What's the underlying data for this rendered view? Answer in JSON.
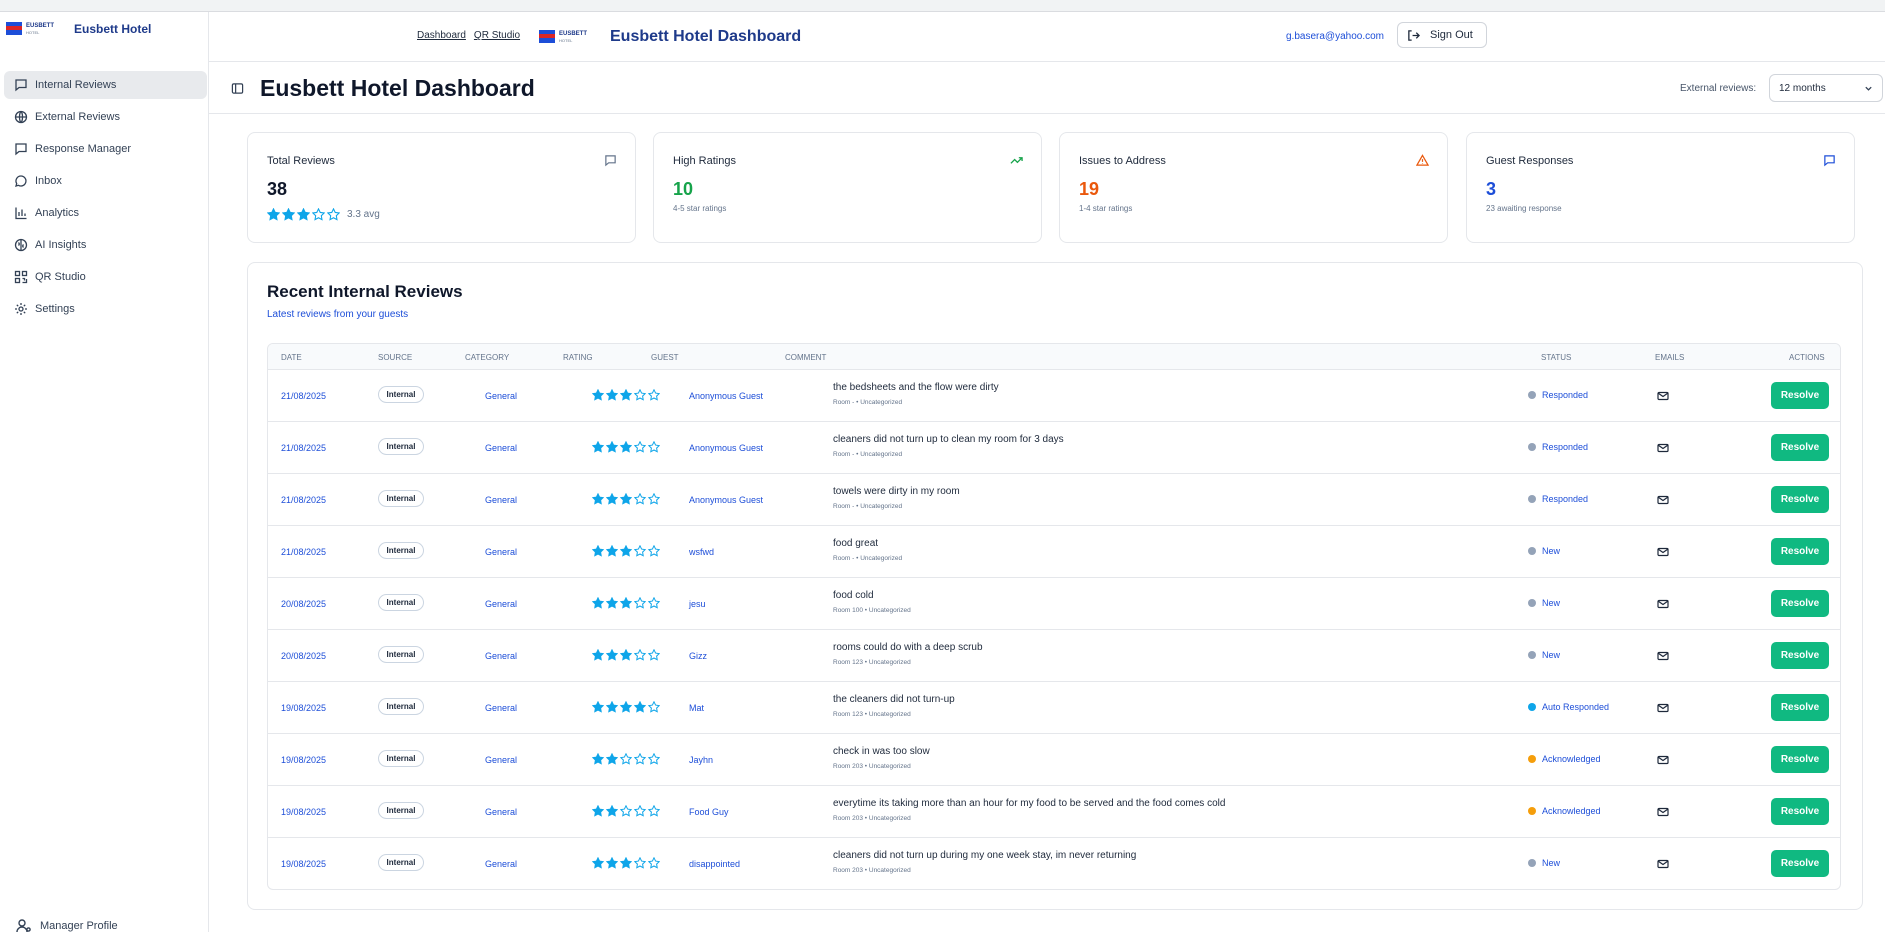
{
  "brand": {
    "name": "Eusbett Hotel",
    "logo_text": "EUSBETT",
    "logo_subtext": "HOTEL"
  },
  "sidebar": {
    "items": [
      {
        "label": "Internal Reviews",
        "icon": "message-square-icon",
        "active": true
      },
      {
        "label": "External Reviews",
        "icon": "globe-icon",
        "active": false
      },
      {
        "label": "Response Manager",
        "icon": "message-square-icon",
        "active": false
      },
      {
        "label": "Inbox",
        "icon": "message-circle-icon",
        "active": false
      },
      {
        "label": "Analytics",
        "icon": "bar-chart-icon",
        "active": false
      },
      {
        "label": "AI Insights",
        "icon": "brain-icon",
        "active": false
      },
      {
        "label": "QR Studio",
        "icon": "qr-code-icon",
        "active": false
      },
      {
        "label": "Settings",
        "icon": "gear-icon",
        "active": false
      }
    ],
    "profile_label": "Manager Profile"
  },
  "header": {
    "links": [
      "Dashboard",
      "QR Studio"
    ],
    "title": "Eusbett Hotel Dashboard",
    "email": "g.basera@yahoo.com",
    "signout_label": "Sign Out"
  },
  "page": {
    "title": "Eusbett Hotel Dashboard",
    "external_label": "External reviews:",
    "external_value": "12 months"
  },
  "stats": [
    {
      "title": "Total Reviews",
      "value": "38",
      "sub": "3.3 avg",
      "icon": "message-square-icon",
      "color": "#0f172a",
      "stars": 3
    },
    {
      "title": "High Ratings",
      "value": "10",
      "sub": "4-5 star ratings",
      "icon": "trending-up-icon",
      "color": "#16a34a"
    },
    {
      "title": "Issues to Address",
      "value": "19",
      "sub": "1-4 star ratings",
      "icon": "alert-triangle-icon",
      "color": "#ea580c"
    },
    {
      "title": "Guest Responses",
      "value": "3",
      "sub": "23 awaiting response",
      "icon": "message-square-icon",
      "color": "#1d4ed8"
    }
  ],
  "reviews": {
    "title": "Recent Internal Reviews",
    "subtitle": "Latest reviews from your guests",
    "columns": [
      "Date",
      "Source",
      "Category",
      "Rating",
      "Guest",
      "Comment",
      "Status",
      "Emails",
      "Actions"
    ],
    "rows": [
      {
        "date": "21/08/2025",
        "source": "Internal",
        "category": "General",
        "rating": 3,
        "guest": "Anonymous Guest",
        "comment": "the bedsheets and the flow were dirty",
        "meta": "Room - • Uncategorized",
        "status": "Responded",
        "status_color": "#94a3b8",
        "action": "Resolve"
      },
      {
        "date": "21/08/2025",
        "source": "Internal",
        "category": "General",
        "rating": 3,
        "guest": "Anonymous Guest",
        "comment": "cleaners did not turn up to clean my room for 3 days",
        "meta": "Room - • Uncategorized",
        "status": "Responded",
        "status_color": "#94a3b8",
        "action": "Resolve"
      },
      {
        "date": "21/08/2025",
        "source": "Internal",
        "category": "General",
        "rating": 3,
        "guest": "Anonymous Guest",
        "comment": "towels were dirty in my room",
        "meta": "Room - • Uncategorized",
        "status": "Responded",
        "status_color": "#94a3b8",
        "action": "Resolve"
      },
      {
        "date": "21/08/2025",
        "source": "Internal",
        "category": "General",
        "rating": 3,
        "guest": "wsfwd",
        "comment": "food great",
        "meta": "Room - • Uncategorized",
        "status": "New",
        "status_color": "#94a3b8",
        "action": "Resolve"
      },
      {
        "date": "20/08/2025",
        "source": "Internal",
        "category": "General",
        "rating": 3,
        "guest": "jesu",
        "comment": "food cold",
        "meta": "Room 100 • Uncategorized",
        "status": "New",
        "status_color": "#94a3b8",
        "action": "Resolve"
      },
      {
        "date": "20/08/2025",
        "source": "Internal",
        "category": "General",
        "rating": 3,
        "guest": "Gizz",
        "comment": "rooms could do with a deep scrub",
        "meta": "Room 123 • Uncategorized",
        "status": "New",
        "status_color": "#94a3b8",
        "action": "Resolve"
      },
      {
        "date": "19/08/2025",
        "source": "Internal",
        "category": "General",
        "rating": 4,
        "guest": "Mat",
        "comment": "the cleaners did not turn-up",
        "meta": "Room 123 • Uncategorized",
        "status": "Auto Responded",
        "status_color": "#0ea5e9",
        "action": "Resolve"
      },
      {
        "date": "19/08/2025",
        "source": "Internal",
        "category": "General",
        "rating": 2,
        "guest": "Jayhn",
        "comment": "check in was too slow",
        "meta": "Room 203 • Uncategorized",
        "status": "Acknowledged",
        "status_color": "#f59e0b",
        "action": "Resolve"
      },
      {
        "date": "19/08/2025",
        "source": "Internal",
        "category": "General",
        "rating": 2,
        "guest": "Food Guy",
        "comment": "everytime its taking more than an hour for my food to be served and the food comes cold",
        "meta": "Room 203 • Uncategorized",
        "status": "Acknowledged",
        "status_color": "#f59e0b",
        "action": "Resolve"
      },
      {
        "date": "19/08/2025",
        "source": "Internal",
        "category": "General",
        "rating": 3,
        "guest": "disappointed",
        "comment": "cleaners did not turn up during my one week stay, im never returning",
        "meta": "Room 203 • Uncategorized",
        "status": "New",
        "status_color": "#94a3b8",
        "action": "Resolve"
      }
    ]
  },
  "colors": {
    "star": "#0ea5e9",
    "accent": "#1d4ed8",
    "resolve": "#10b981"
  }
}
